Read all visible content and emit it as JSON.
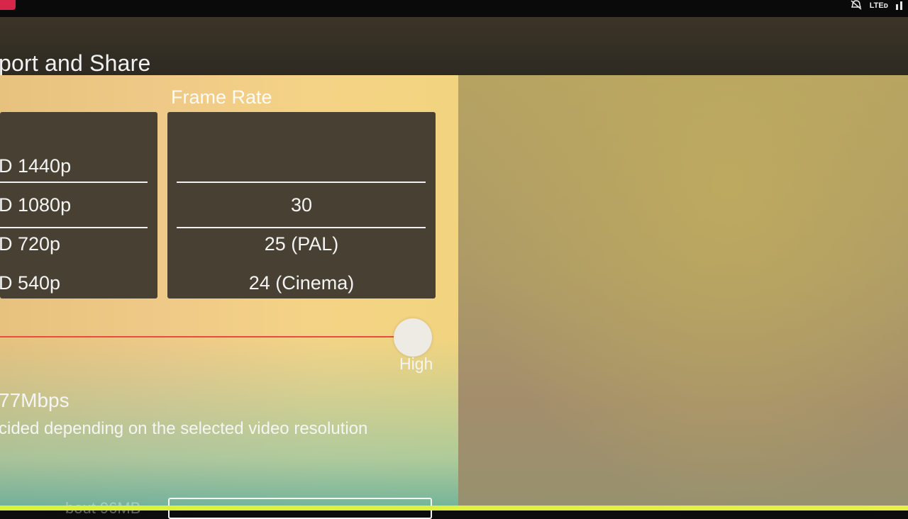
{
  "status_bar": {
    "network": "LTEᴅ"
  },
  "app_bar": {
    "title": "port and Share"
  },
  "resolution": {
    "items": [
      "D 1440p",
      "D 1080p",
      "D 720p",
      "D 540p"
    ],
    "selected": "D 1080p"
  },
  "frame_rate": {
    "label": "Frame Rate",
    "items": [
      "",
      "30",
      "25 (PAL)",
      "24 (Cinema)"
    ],
    "selected": "30"
  },
  "bitrate": {
    "level_label": "High",
    "level_fraction": 1.0,
    "value_text": "77Mbps",
    "note": "cided depending on the selected video resolution"
  },
  "footer": {
    "faded_text": "bout 96MB"
  },
  "colors": {
    "slider_track": "#e44d3f",
    "accent_strip": "#d9f23a"
  }
}
